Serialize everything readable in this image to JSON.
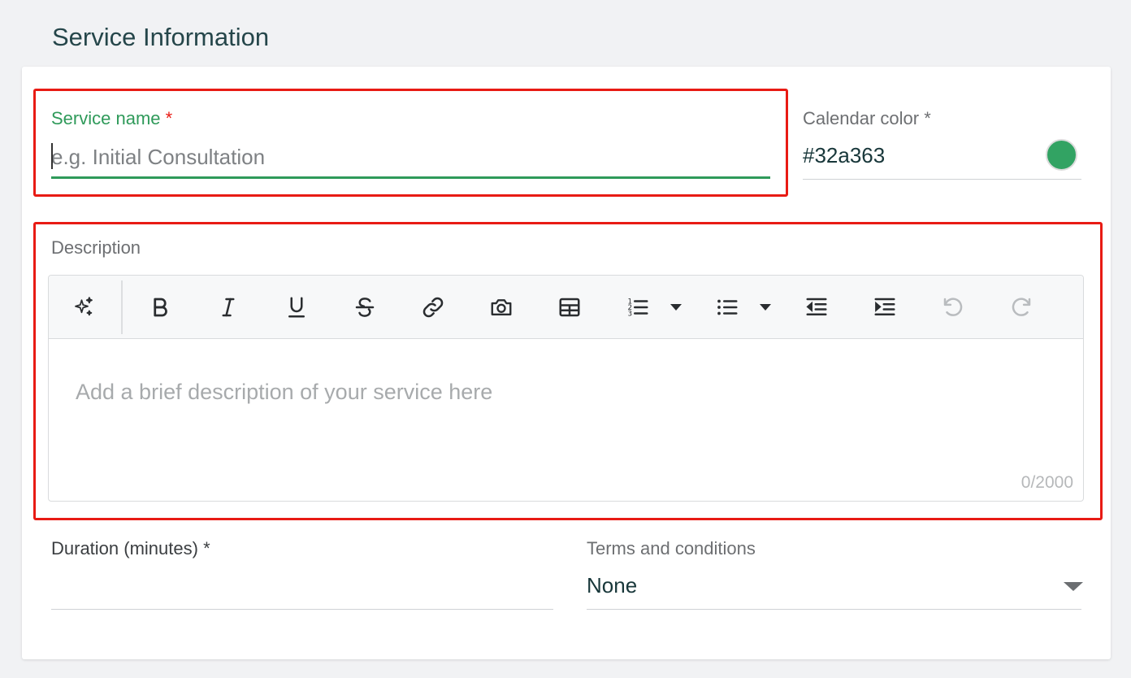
{
  "section": {
    "title": "Service Information"
  },
  "service_name": {
    "label": "Service name",
    "required_mark": "*",
    "placeholder": "e.g. Initial Consultation",
    "value": ""
  },
  "calendar_color": {
    "label": "Calendar color *",
    "value": "#32a363",
    "swatch_color": "#32a363"
  },
  "description": {
    "label": "Description",
    "placeholder": "Add a brief description of your service here",
    "char_count": "0/2000",
    "toolbar": [
      {
        "name": "ai-assist",
        "icon": "sparkles-icon",
        "enabled": true
      },
      {
        "name": "bold",
        "icon": "bold-icon",
        "enabled": true
      },
      {
        "name": "italic",
        "icon": "italic-icon",
        "enabled": true
      },
      {
        "name": "underline",
        "icon": "underline-icon",
        "enabled": true
      },
      {
        "name": "strikethrough",
        "icon": "strikethrough-icon",
        "enabled": true
      },
      {
        "name": "link",
        "icon": "link-icon",
        "enabled": true
      },
      {
        "name": "image",
        "icon": "camera-icon",
        "enabled": true
      },
      {
        "name": "table",
        "icon": "table-icon",
        "enabled": true
      },
      {
        "name": "ordered-list",
        "icon": "ordered-list-icon",
        "enabled": true
      },
      {
        "name": "bullet-list",
        "icon": "bullet-list-icon",
        "enabled": true
      },
      {
        "name": "outdent",
        "icon": "outdent-icon",
        "enabled": true
      },
      {
        "name": "indent",
        "icon": "indent-icon",
        "enabled": true
      },
      {
        "name": "undo",
        "icon": "undo-icon",
        "enabled": false
      },
      {
        "name": "redo",
        "icon": "redo-icon",
        "enabled": false
      }
    ]
  },
  "duration": {
    "label": "Duration (minutes) *",
    "value": ""
  },
  "terms": {
    "label": "Terms and conditions",
    "selected": "None"
  },
  "colors": {
    "accent": "#2f9a5a",
    "highlight_border": "#e81b14",
    "title": "#25464a"
  }
}
